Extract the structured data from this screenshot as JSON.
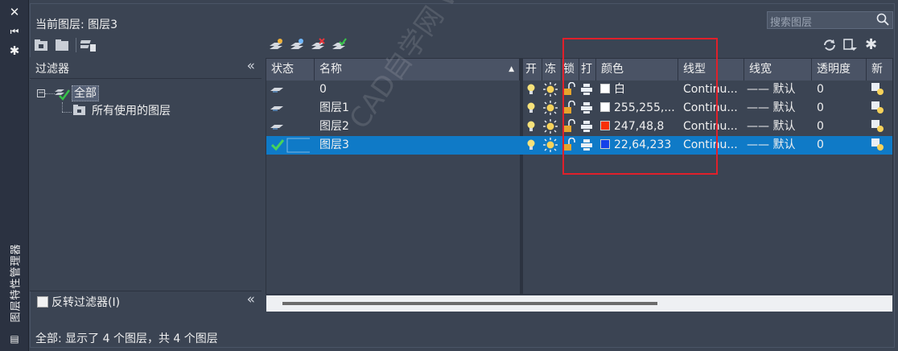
{
  "panel": {
    "vertical_title": "图层特性管理器",
    "current_layer_label": "当前图层: 图层3",
    "search_placeholder": "搜索图层"
  },
  "filters": {
    "header": "过滤器",
    "tree": [
      {
        "label": "全部",
        "selected": true
      },
      {
        "label": "所有使用的图层",
        "selected": false
      }
    ],
    "invert_label": "反转过滤器(I)"
  },
  "columns": {
    "status": "状态",
    "name": "名称",
    "on": "开",
    "freeze": "冻",
    "lock": "锁",
    "plot": "打",
    "color": "颜色",
    "linetype": "线型",
    "lineweight": "线宽",
    "transparency": "透明度",
    "new_vp": "新"
  },
  "layers": [
    {
      "name": "0",
      "color_name": "白",
      "color_hex": "#ffffff",
      "linetype": "Continu...",
      "lineweight": "—— 默认",
      "transparency": "0",
      "current": false
    },
    {
      "name": "图层1",
      "color_name": "255,255,...",
      "color_hex": "#ffffff",
      "linetype": "Continu...",
      "lineweight": "—— 默认",
      "transparency": "0",
      "current": false
    },
    {
      "name": "图层2",
      "color_name": "247,48,8",
      "color_hex": "#f73008",
      "linetype": "Continu...",
      "lineweight": "—— 默认",
      "transparency": "0",
      "current": false
    },
    {
      "name": "图层3",
      "color_name": "22,64,233",
      "color_hex": "#1640e9",
      "linetype": "Continu...",
      "lineweight": "—— 默认",
      "transparency": "0",
      "current": true
    }
  ],
  "status_text": "全部: 显示了 4 个图层，共 4 个图层",
  "watermark": "CAD自学网 www.cadzxw.com",
  "colors": {
    "accent_select": "#0f7ac7",
    "highlight_box": "#e0202a",
    "panel_bg": "#3b4453"
  }
}
